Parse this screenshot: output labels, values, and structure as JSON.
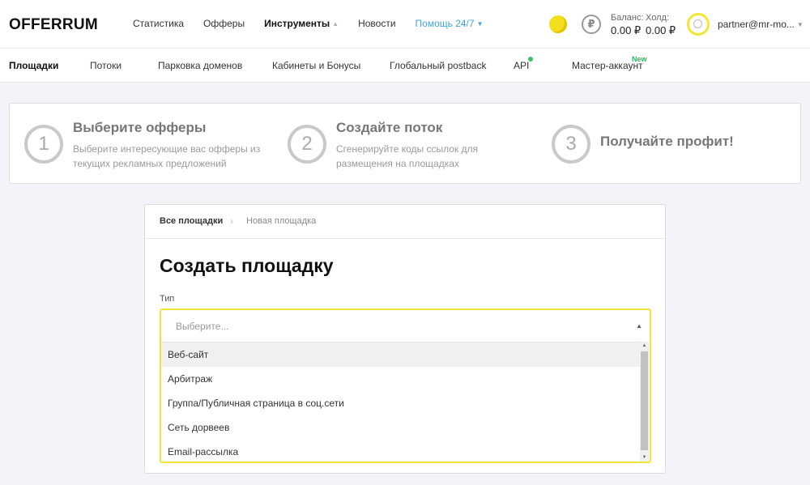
{
  "header": {
    "logo": "OFFERRUM",
    "nav": [
      {
        "label": "Статистика"
      },
      {
        "label": "Офферы"
      },
      {
        "label": "Инструменты"
      },
      {
        "label": "Новости"
      },
      {
        "label": "Помощь 24/7"
      }
    ],
    "active_nav": "Инструменты",
    "currency_icon": "₽",
    "balance": {
      "label": "Баланс:",
      "value": "0.00 ₽"
    },
    "hold": {
      "label": "Холд:",
      "value": "0.00 ₽"
    },
    "user_email": "partner@mr-mo..."
  },
  "subnav": {
    "items": [
      {
        "label": "Площадки"
      },
      {
        "label": "Потоки"
      },
      {
        "label": "Парковка доменов"
      },
      {
        "label": "Кабинеты и Бонусы"
      },
      {
        "label": "Глобальный postback"
      },
      {
        "label": "API"
      },
      {
        "label": "Мастер-аккаунт"
      }
    ],
    "active": "Площадки",
    "new_badge": "New"
  },
  "steps": [
    {
      "num": "1",
      "title": "Выберите офферы",
      "desc1": "Выберите интересующие вас офферы из",
      "desc2": "текущих рекламных предложений"
    },
    {
      "num": "2",
      "title": "Создайте поток",
      "desc1": "Сгенерируйте коды ссылок для",
      "desc2": "размещения на площадках"
    },
    {
      "num": "3",
      "title": "Получайте профит!"
    }
  ],
  "form": {
    "breadcrumb": {
      "root": "Все площадки",
      "separator": "›",
      "current": "Новая площадка"
    },
    "title": "Создать площадку",
    "type_label": "Тип",
    "type_placeholder": "Выберите...",
    "type_options": [
      "Веб-сайт",
      "Арбитраж",
      "Группа/Публичная страница в соц.сети",
      "Сеть дорвеев",
      "Email-рассылка"
    ]
  },
  "colors": {
    "accent_yellow": "#f3e43a",
    "help_link": "#3ea4d9",
    "new_green": "#2fb85c",
    "coin": "#f5de1e"
  }
}
